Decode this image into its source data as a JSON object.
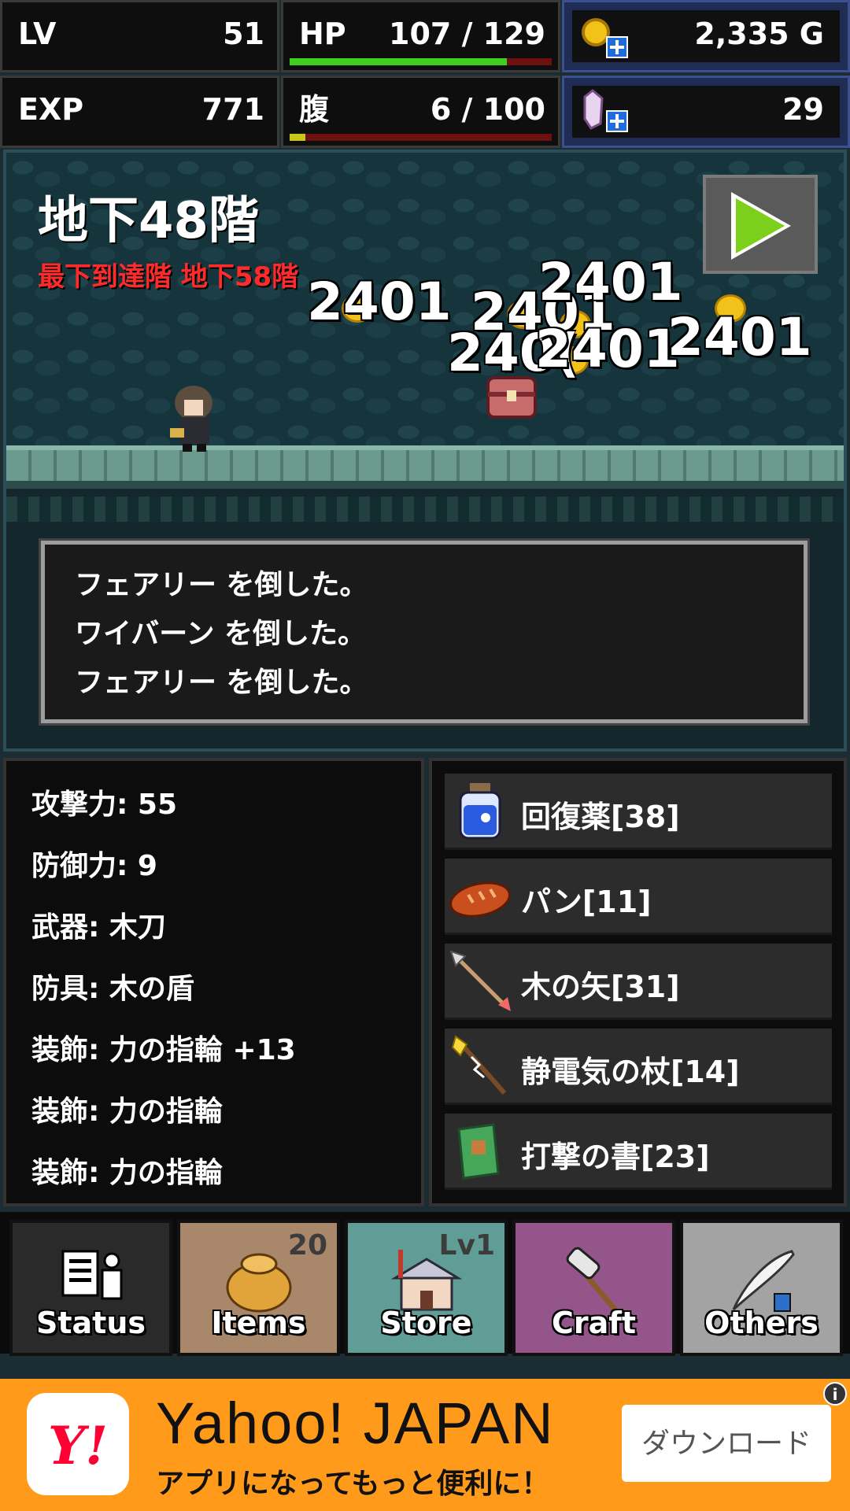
{
  "hud": {
    "lv_label": "LV",
    "lv_value": "51",
    "hp_label": "HP",
    "hp_value": "107 / 129",
    "hp_ratio": 0.829,
    "exp_label": "EXP",
    "exp_value": "771",
    "hunger_label": "腹",
    "hunger_value": "6 / 100",
    "hunger_ratio": 0.06,
    "gold_value": "2,335 G",
    "crystal_value": "29",
    "colors": {
      "hp_fill": "#3ecf1e",
      "hunger_fill": "#c7c619",
      "bar_bg": "#6d1010"
    }
  },
  "scene": {
    "floor_name": "地下48階",
    "deepest_floor": "最下到達階 地下58階",
    "damage_numbers": [
      "2401",
      "2401",
      "2401",
      "240(",
      "2401",
      "2401"
    ],
    "play_icon": "play-icon"
  },
  "log": {
    "lines": [
      "フェアリー を倒した。",
      "ワイバーン を倒した。",
      "フェアリー を倒した。"
    ]
  },
  "stats": {
    "lines": [
      "攻撃力: 55",
      "防御力: 9",
      "武器: 木刀",
      "防具: 木の盾",
      "装飾: 力の指輪 +13",
      "装飾: 力の指輪",
      "装飾: 力の指輪"
    ]
  },
  "inventory": {
    "items": [
      {
        "name": "回復薬[38]",
        "icon": "potion-icon"
      },
      {
        "name": "パン[11]",
        "icon": "bread-icon"
      },
      {
        "name": "木の矢[31]",
        "icon": "arrow-icon"
      },
      {
        "name": "静電気の杖[14]",
        "icon": "staff-icon"
      },
      {
        "name": "打撃の書[23]",
        "icon": "book-icon"
      }
    ]
  },
  "nav": {
    "tabs": [
      {
        "label": "Status",
        "badge": "",
        "color": "#2a2a2a",
        "icon": "status-icon"
      },
      {
        "label": "Items",
        "badge": "20",
        "color": "#a8876a",
        "icon": "bag-icon"
      },
      {
        "label": "Store",
        "badge": "Lv1",
        "color": "#5f9d96",
        "icon": "shop-icon"
      },
      {
        "label": "Craft",
        "badge": "",
        "color": "#94568a",
        "icon": "hammer-icon"
      },
      {
        "label": "Others",
        "badge": "",
        "color": "#a3a3a3",
        "icon": "quill-icon"
      }
    ]
  },
  "ad": {
    "logo": "Y!",
    "title": "Yahoo! JAPAN",
    "subtitle": "アプリになってもっと便利に！",
    "button": "ダウンロード",
    "info": "i"
  }
}
